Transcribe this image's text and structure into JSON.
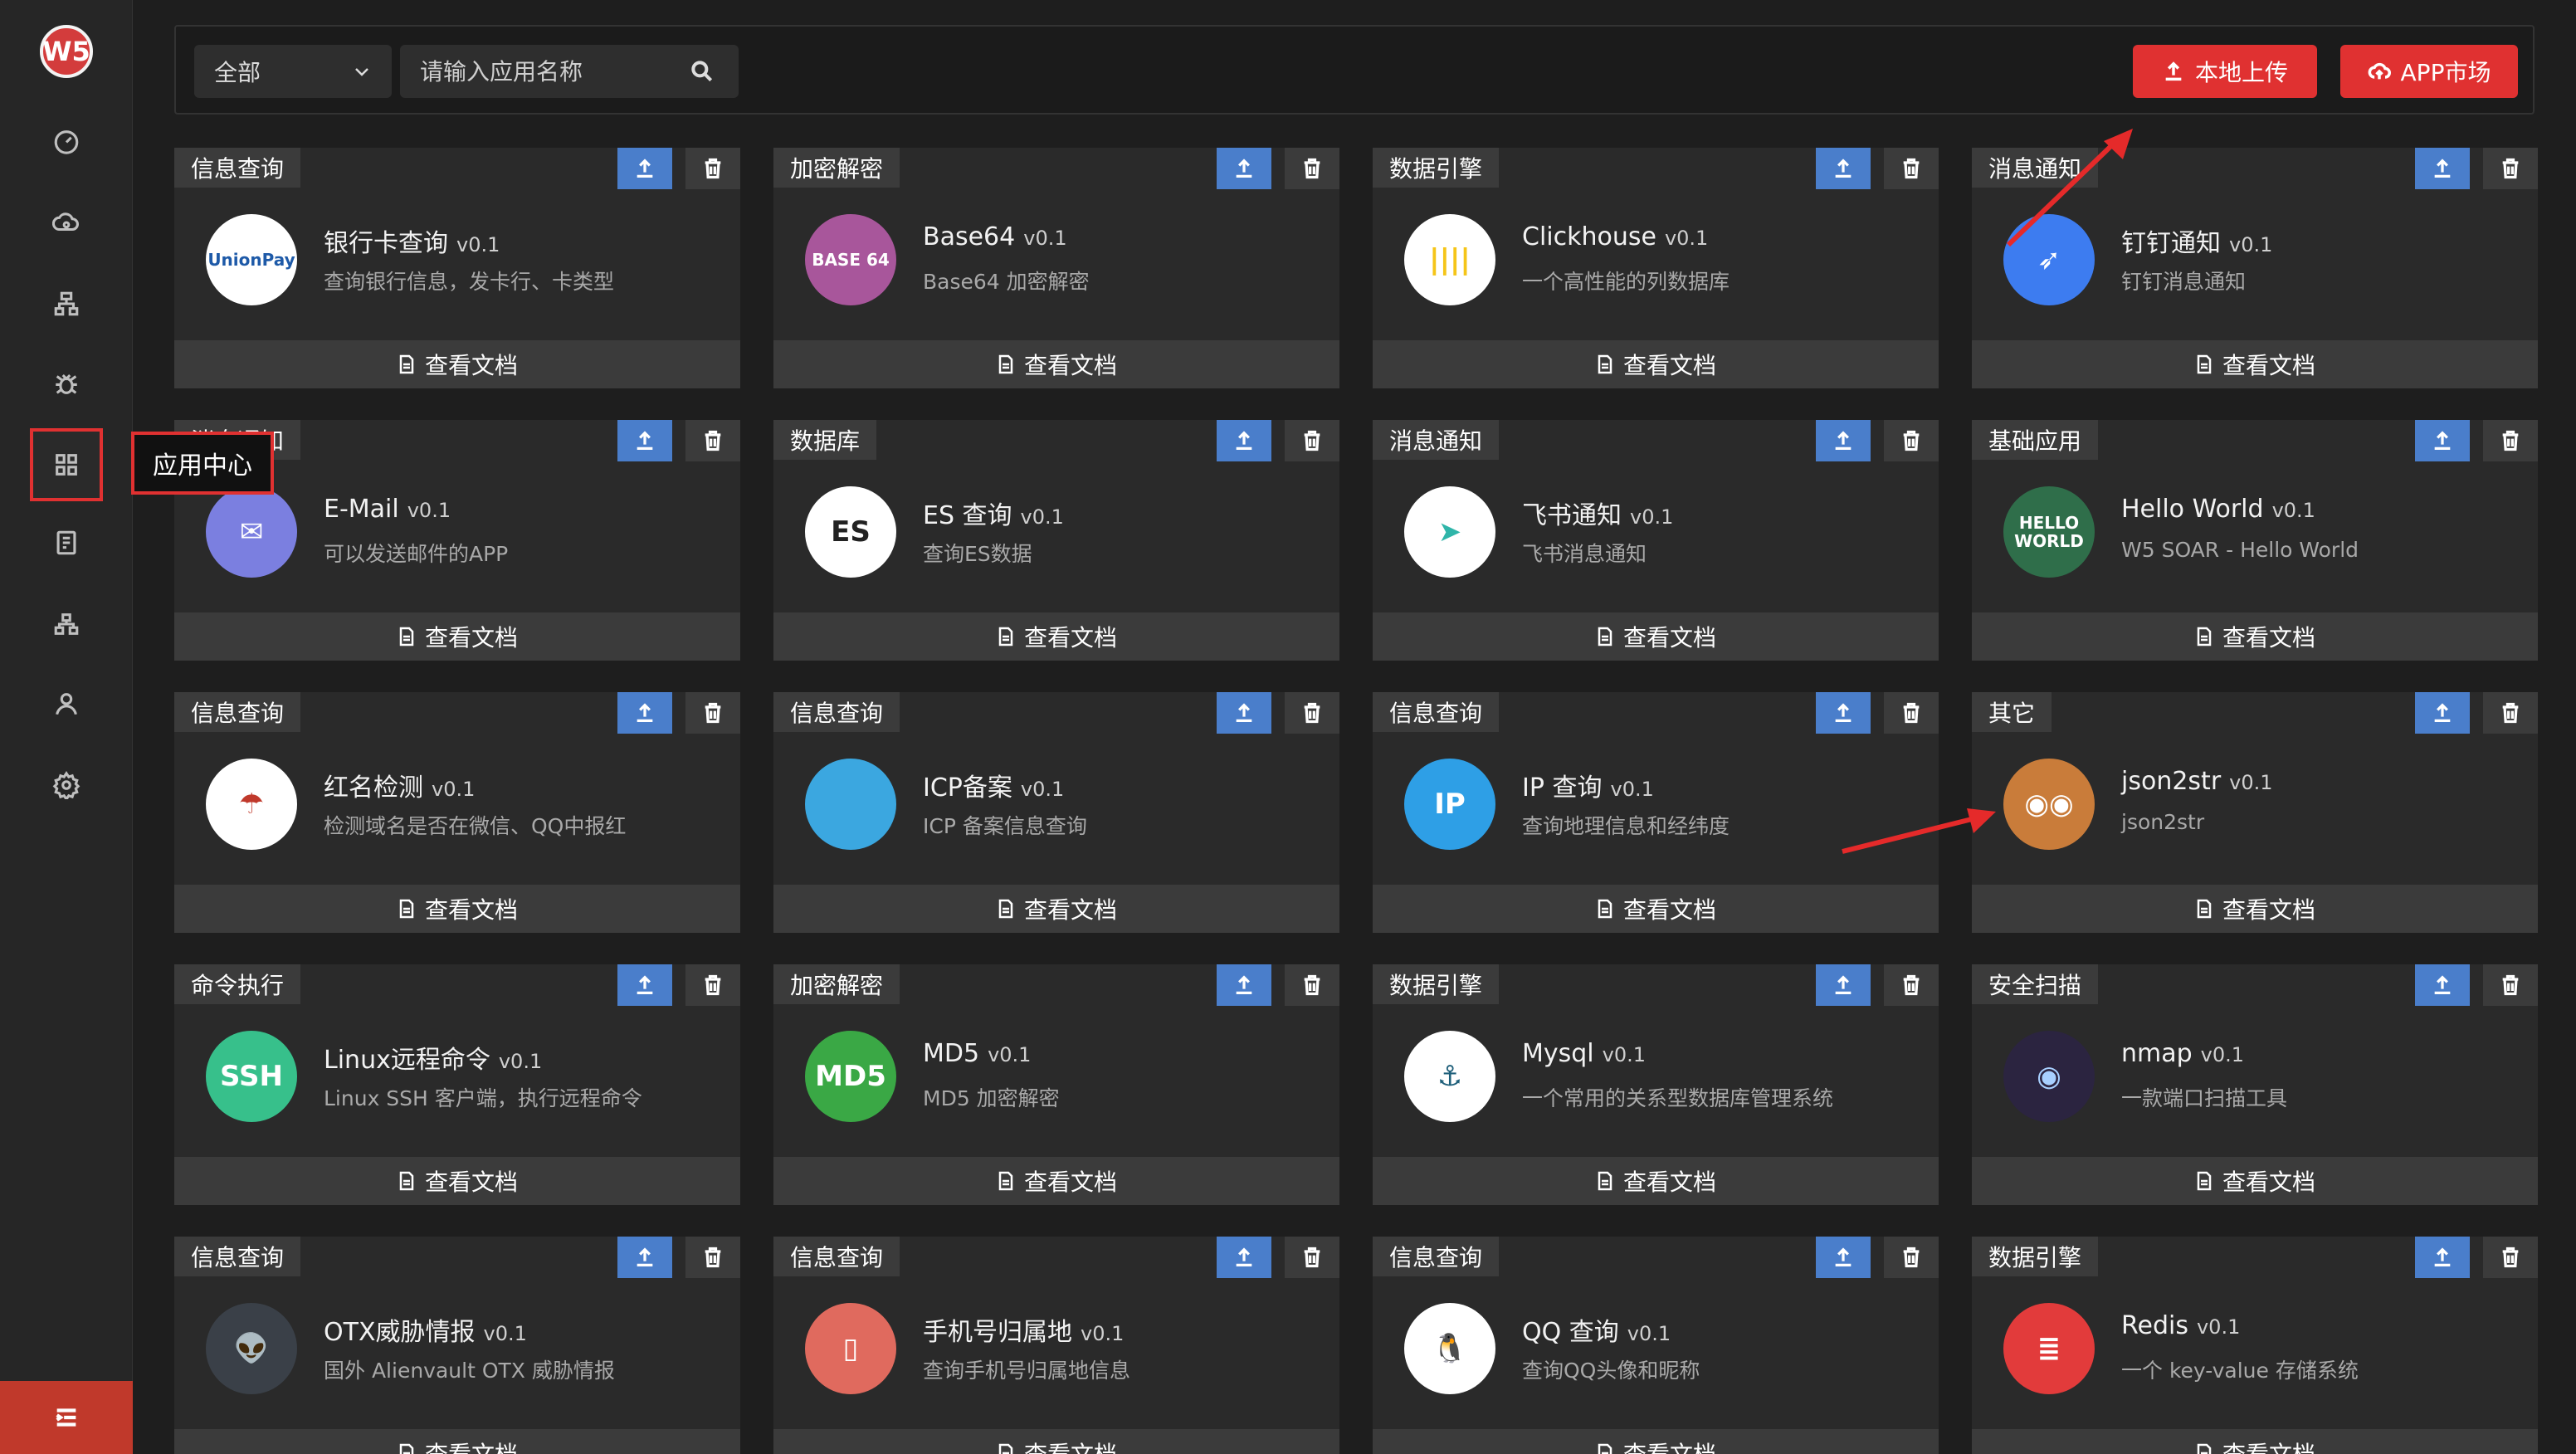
{
  "sidebar": {
    "logo_label": "W5",
    "nav_items": [
      "dashboard",
      "workflow",
      "structure",
      "bug",
      "apps",
      "report",
      "org",
      "user",
      "settings"
    ],
    "tooltip": "应用中心",
    "accent": "#e03131"
  },
  "toolbar": {
    "category_select": "全部",
    "search_placeholder": "请输入应用名称",
    "upload_label": "本地上传",
    "market_label": "APP市场"
  },
  "doc_label": "查看文档",
  "apps": [
    {
      "tag": "信息查询",
      "name": "银行卡查询",
      "version": "v0.1",
      "desc": "查询银行信息，发卡行、卡类型",
      "icon": "unionpay",
      "color": "#ffffff",
      "text": "UnionPay",
      "textColor": "#1e5aa8"
    },
    {
      "tag": "加密解密",
      "name": "Base64",
      "version": "v0.1",
      "desc": "Base64 加密解密",
      "icon": "base64",
      "color": "#a8569b",
      "text": "BASE 64",
      "textColor": "#ffffff"
    },
    {
      "tag": "数据引擎",
      "name": "Clickhouse",
      "version": "v0.1",
      "desc": "一个高性能的列数据库",
      "icon": "clickhouse",
      "color": "#ffffff",
      "text": "||||",
      "textColor": "#f5c518"
    },
    {
      "tag": "消息通知",
      "name": "钉钉通知",
      "version": "v0.1",
      "desc": "钉钉消息通知",
      "icon": "dingtalk",
      "color": "#3d7cf0",
      "text": "➶",
      "textColor": "#ffffff"
    },
    {
      "tag": "消息通知",
      "name": "E-Mail",
      "version": "v0.1",
      "desc": "可以发送邮件的APP",
      "icon": "email",
      "color": "#7b7fe0",
      "text": "✉",
      "textColor": "#ffffff"
    },
    {
      "tag": "数据库",
      "name": "ES 查询",
      "version": "v0.1",
      "desc": "查询ES数据",
      "icon": "elasticsearch",
      "color": "#ffffff",
      "text": "ES",
      "textColor": "#222222"
    },
    {
      "tag": "消息通知",
      "name": "飞书通知",
      "version": "v0.1",
      "desc": "飞书消息通知",
      "icon": "feishu",
      "color": "#ffffff",
      "text": "➤",
      "textColor": "#2fb5a9"
    },
    {
      "tag": "基础应用",
      "name": "Hello World",
      "version": "v0.1",
      "desc": "W5 SOAR - Hello World",
      "icon": "helloworld",
      "color": "#2f6e4a",
      "text": "HELLO WORLD",
      "textColor": "#ffffff"
    },
    {
      "tag": "信息查询",
      "name": "红名检测",
      "version": "v0.1",
      "desc": "检测域名是否在微信、QQ中报红",
      "icon": "umbrella",
      "color": "#ffffff",
      "text": "☂",
      "textColor": "#c0392b"
    },
    {
      "tag": "信息查询",
      "name": "ICP备案",
      "version": "v0.1",
      "desc": "ICP 备案信息查询",
      "icon": "globe",
      "color": "#3ba7e0",
      "text": "",
      "textColor": "#ffffff"
    },
    {
      "tag": "信息查询",
      "name": "IP 查询",
      "version": "v0.1",
      "desc": "查询地理信息和经纬度",
      "icon": "ip",
      "color": "#2e9fe6",
      "text": "IP",
      "textColor": "#ffffff"
    },
    {
      "tag": "其它",
      "name": "json2str",
      "version": "v0.1",
      "desc": "json2str",
      "icon": "json",
      "color": "#c97c3a",
      "text": "◉◉",
      "textColor": "#ffffff"
    },
    {
      "tag": "命令执行",
      "name": "Linux远程命令",
      "version": "v0.1",
      "desc": "Linux SSH 客户端，执行远程命令",
      "icon": "ssh",
      "color": "#37c08b",
      "text": "SSH",
      "textColor": "#ffffff"
    },
    {
      "tag": "加密解密",
      "name": "MD5",
      "version": "v0.1",
      "desc": "MD5 加密解密",
      "icon": "md5",
      "color": "#3aa845",
      "text": "MD5",
      "textColor": "#ffffff"
    },
    {
      "tag": "数据引擎",
      "name": "Mysql",
      "version": "v0.1",
      "desc": "一个常用的关系型数据库管理系统",
      "icon": "mysql",
      "color": "#ffffff",
      "text": "⚓",
      "textColor": "#1e5f7a"
    },
    {
      "tag": "安全扫描",
      "name": "nmap",
      "version": "v0.1",
      "desc": "一款端口扫描工具",
      "icon": "nmap",
      "color": "#2b2440",
      "text": "◉",
      "textColor": "#a8d0ff"
    },
    {
      "tag": "信息查询",
      "name": "OTX威胁情报",
      "version": "v0.1",
      "desc": "国外 Alienvault OTX 威胁情报",
      "icon": "alien",
      "color": "#3a4048",
      "text": "👽",
      "textColor": "#ffffff"
    },
    {
      "tag": "信息查询",
      "name": "手机号归属地",
      "version": "v0.1",
      "desc": "查询手机号归属地信息",
      "icon": "phone",
      "color": "#e06a5e",
      "text": "▯",
      "textColor": "#ffffff"
    },
    {
      "tag": "信息查询",
      "name": "QQ 查询",
      "version": "v0.1",
      "desc": "查询QQ头像和昵称",
      "icon": "qq",
      "color": "#ffffff",
      "text": "🐧",
      "textColor": "#111111"
    },
    {
      "tag": "数据引擎",
      "name": "Redis",
      "version": "v0.1",
      "desc": "一个 key-value 存储系统",
      "icon": "redis",
      "color": "#e23b3b",
      "text": "≣",
      "textColor": "#ffffff"
    }
  ]
}
